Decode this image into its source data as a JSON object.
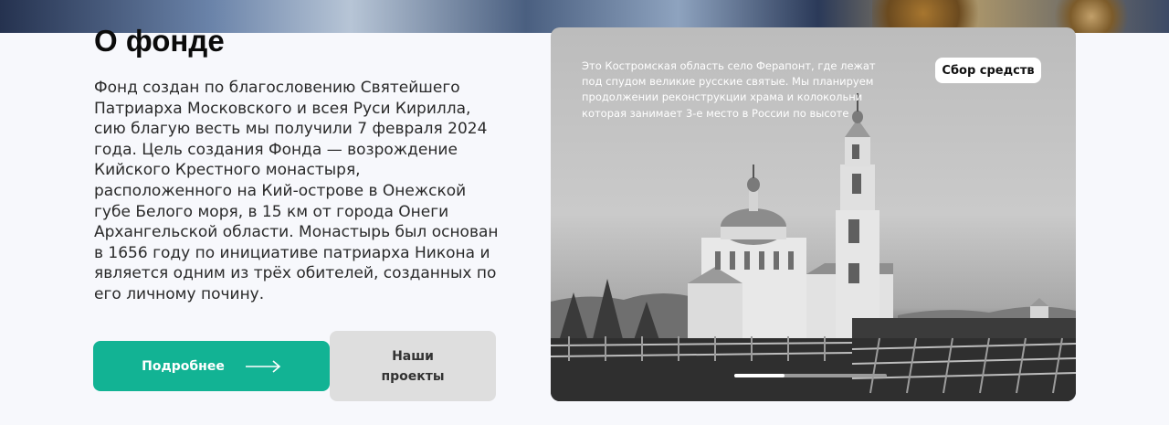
{
  "title": "О фонде",
  "description": "Фонд создан по благословению Святейшего Патриарха Московского и всея Руси Кирилла, сию благую весть мы получили 7 февраля 2024 года. Цель создания Фонда — возрождение Кийского Крестного монастыря, расположенного на Кий-острове в Онежской губе Белого моря, в 15 км от города Онеги Архангельской области. Монастырь был основан в 1656 году по инициативе патриарха Никона и является одним из трёх обителей, созданных по его личному почину.",
  "buttons": {
    "more": "Подробнее",
    "projects": "Наши проекты"
  },
  "slide": {
    "caption": "Это Костромская область село Ферапонт, где лежат под спудом великие русские святые. Мы планируем продолжении реконструкции храма и колокольни которая занимает 3-е место в России по высоте",
    "badge": "Сбор средств",
    "progress": 0.33
  },
  "colors": {
    "accent": "#12b394",
    "secondary_button": "#dedede"
  },
  "icons": {
    "more_arrow": "arrow-right-icon"
  }
}
